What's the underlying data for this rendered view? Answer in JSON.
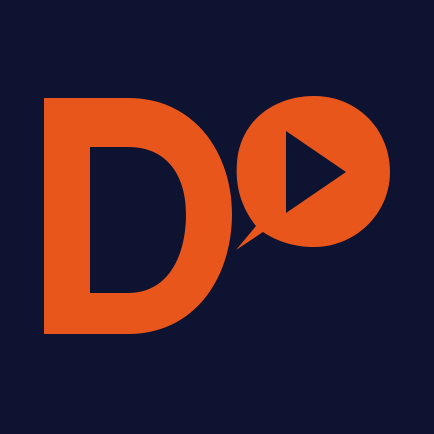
{
  "app_icon": {
    "logo_letter": "D",
    "icon": "play-chat-bubble-icon",
    "colors": {
      "background": "#0d1330",
      "accent": "#e8561c",
      "play_symbol": "#0d1330"
    }
  }
}
